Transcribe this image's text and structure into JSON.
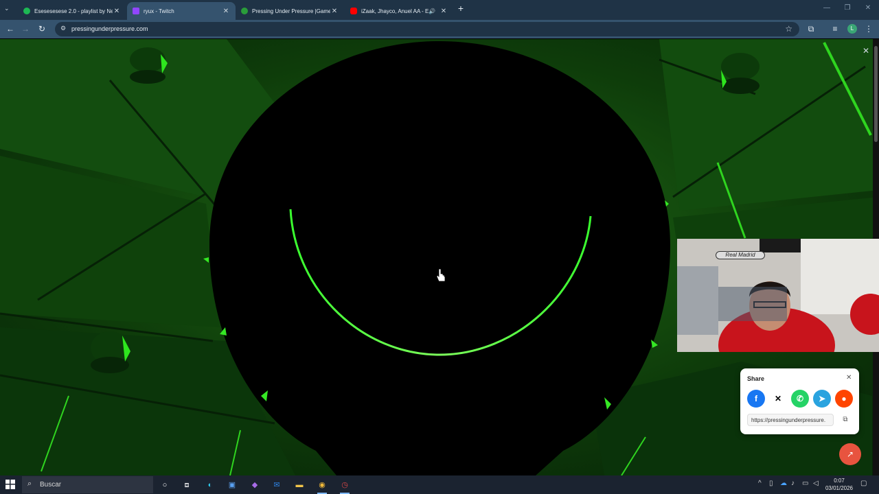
{
  "browser": {
    "tabs": [
      {
        "title": "Esesesesese 2.0 - playlist by Ne",
        "icon": "spotify-icon",
        "color": "#1db954",
        "active": false
      },
      {
        "title": "ryux - Twitch",
        "icon": "twitch-icon",
        "color": "#9146ff",
        "active": true
      },
      {
        "title": "Pressing Under Pressure |Game",
        "icon": "game-icon",
        "color": "#2a9d3a",
        "active": false
      },
      {
        "title": "iZaak, Jhayco, Anuel AA - El",
        "icon": "youtube-icon",
        "color": "#ff0000",
        "active": false
      }
    ],
    "url": "pressingunderpressure.com",
    "profile_initial": "L"
  },
  "share": {
    "title": "Share",
    "url": "https://pressingunderpressure.",
    "buttons": [
      {
        "name": "facebook",
        "glyph": "f",
        "color": "#1877f2"
      },
      {
        "name": "x",
        "glyph": "X",
        "color": "#000000"
      },
      {
        "name": "whatsapp",
        "glyph": "✆",
        "color": "#25d366"
      },
      {
        "name": "telegram",
        "glyph": "➤",
        "color": "#2aa3df"
      },
      {
        "name": "reddit",
        "glyph": "●",
        "color": "#ff4500"
      }
    ]
  },
  "webcam": {
    "sign_text": "Real Madrid"
  },
  "taskbar": {
    "search_placeholder": "Buscar",
    "time": "0:07",
    "date": "03/01/2026",
    "apps": [
      "cortana-icon",
      "task-view-icon",
      "edge-icon",
      "store-icon",
      "visual-studio-icon",
      "outlook-icon",
      "file-explorer-icon",
      "chrome-icon",
      "clock-app-icon"
    ]
  },
  "colors": {
    "accent_green": "#39ff2e",
    "tab_bar": "#1f3346",
    "toolbar": "#35536e"
  }
}
